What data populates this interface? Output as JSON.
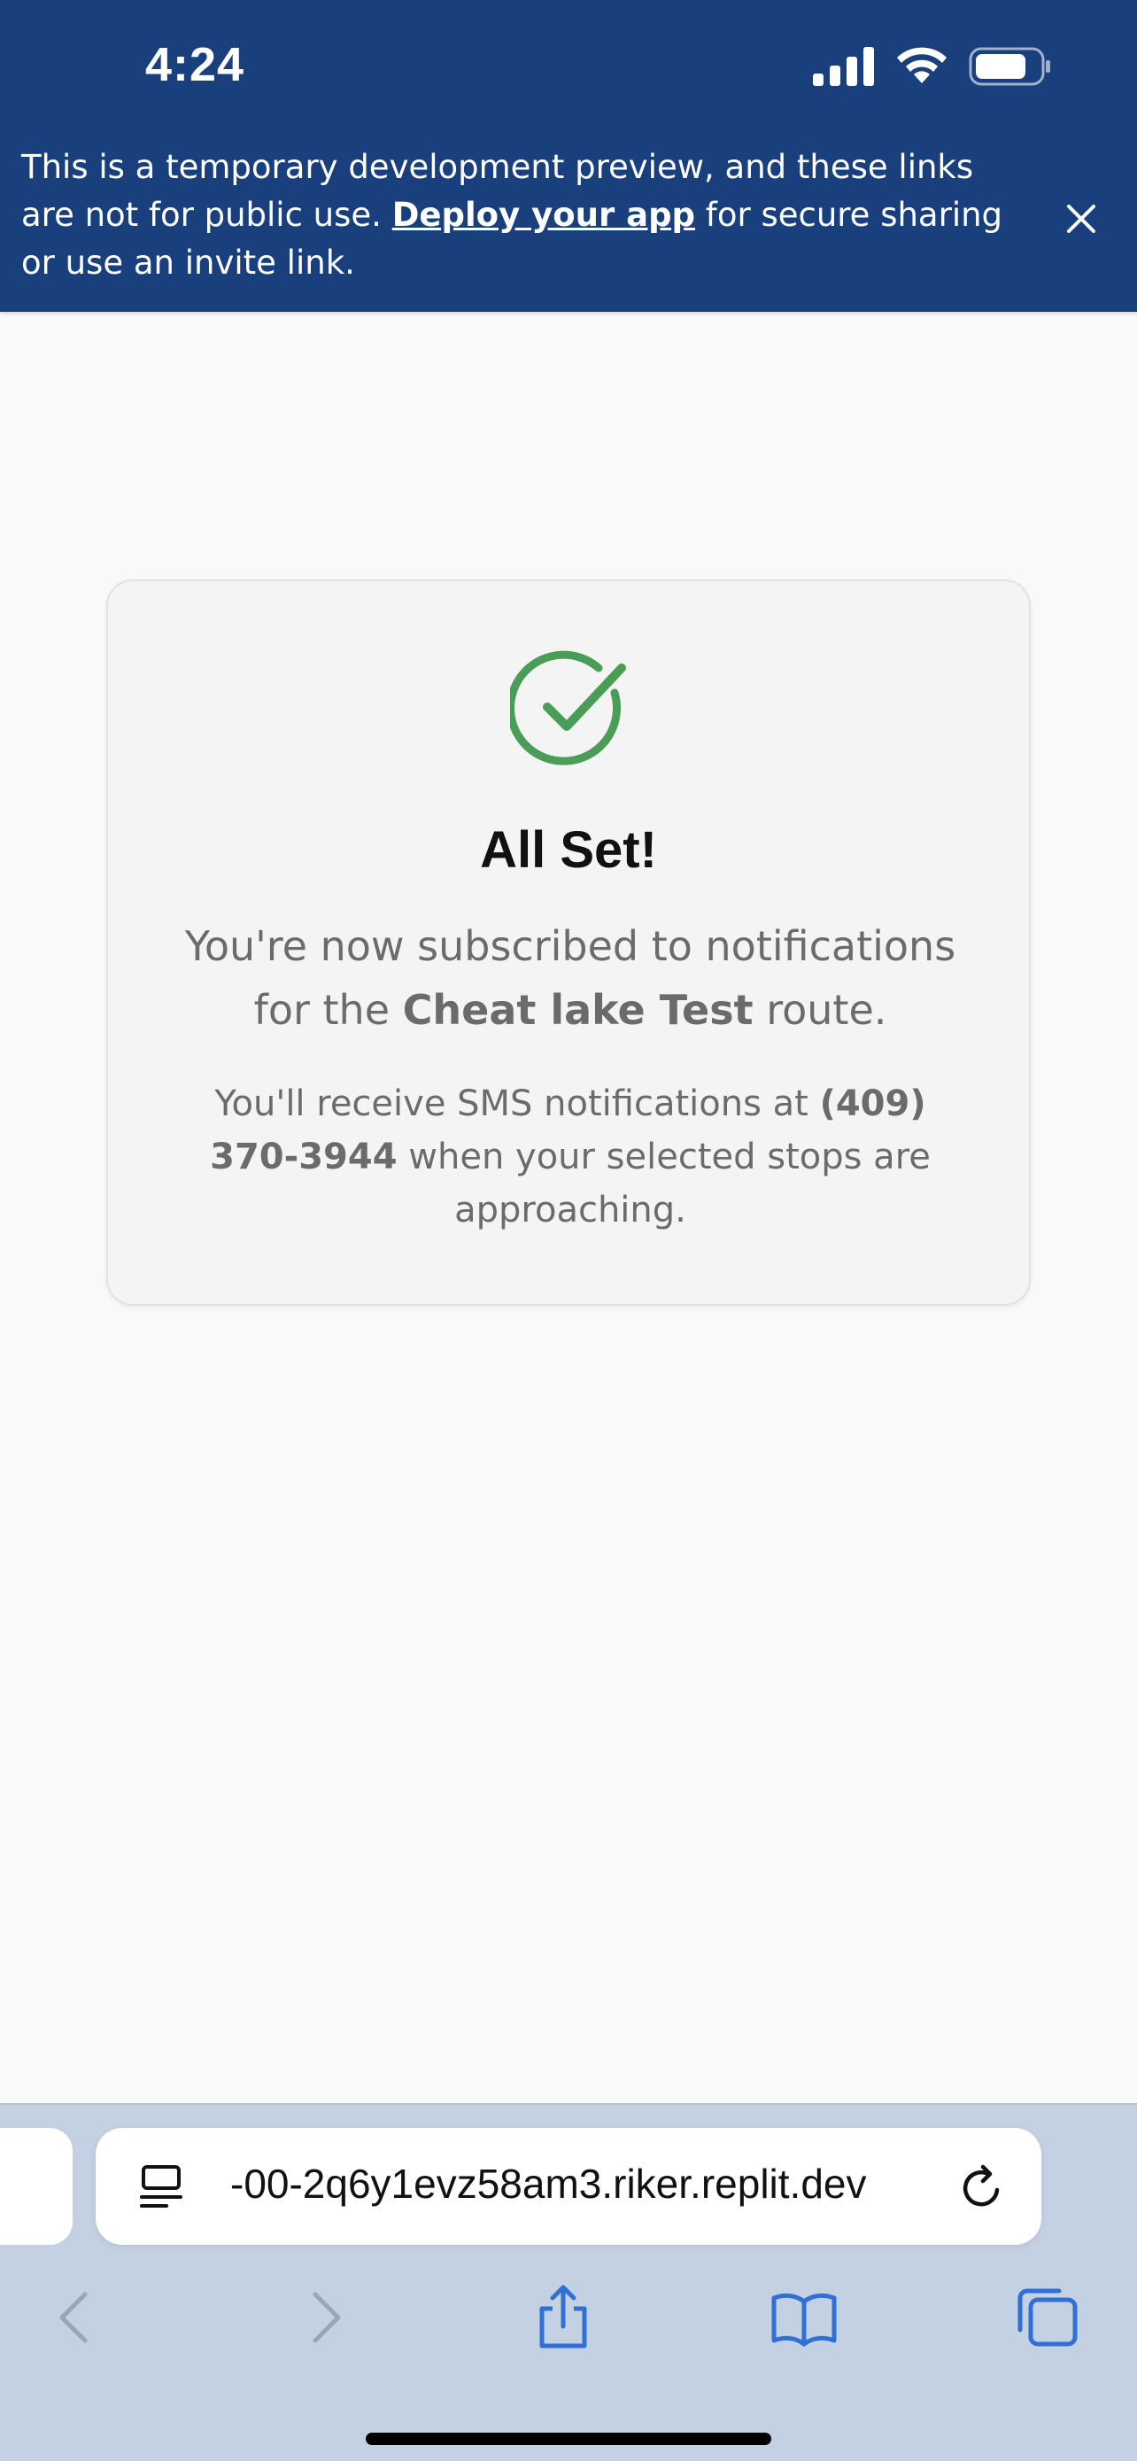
{
  "status_bar": {
    "time": "4:24"
  },
  "banner": {
    "text_before": "This is a temporary development preview, and these links are not for public use. ",
    "link_label": "Deploy your app",
    "text_after": " for secure sharing or use an invite link.",
    "close_icon": "close-icon"
  },
  "card": {
    "icon": "check-circle-icon",
    "title": "All Set!",
    "message_prefix": "You're now subscribed to notifications for the ",
    "route_name": "Cheat lake Test",
    "message_suffix": " route.",
    "sms_prefix": "You'll receive SMS notifications at ",
    "phone": "(409) 370-3944",
    "sms_suffix": " when your selected stops are approaching."
  },
  "browser": {
    "url": "-00-2q6y1evz58am3.riker.replit.dev",
    "toolbar": [
      "back-icon",
      "forward-icon",
      "share-icon",
      "bookmarks-icon",
      "tabs-icon"
    ]
  },
  "colors": {
    "banner_bg": "#19407d",
    "success_green": "#4a9d57",
    "chrome_bg": "#c4d1e3",
    "ios_blue": "#2f6fd6"
  }
}
